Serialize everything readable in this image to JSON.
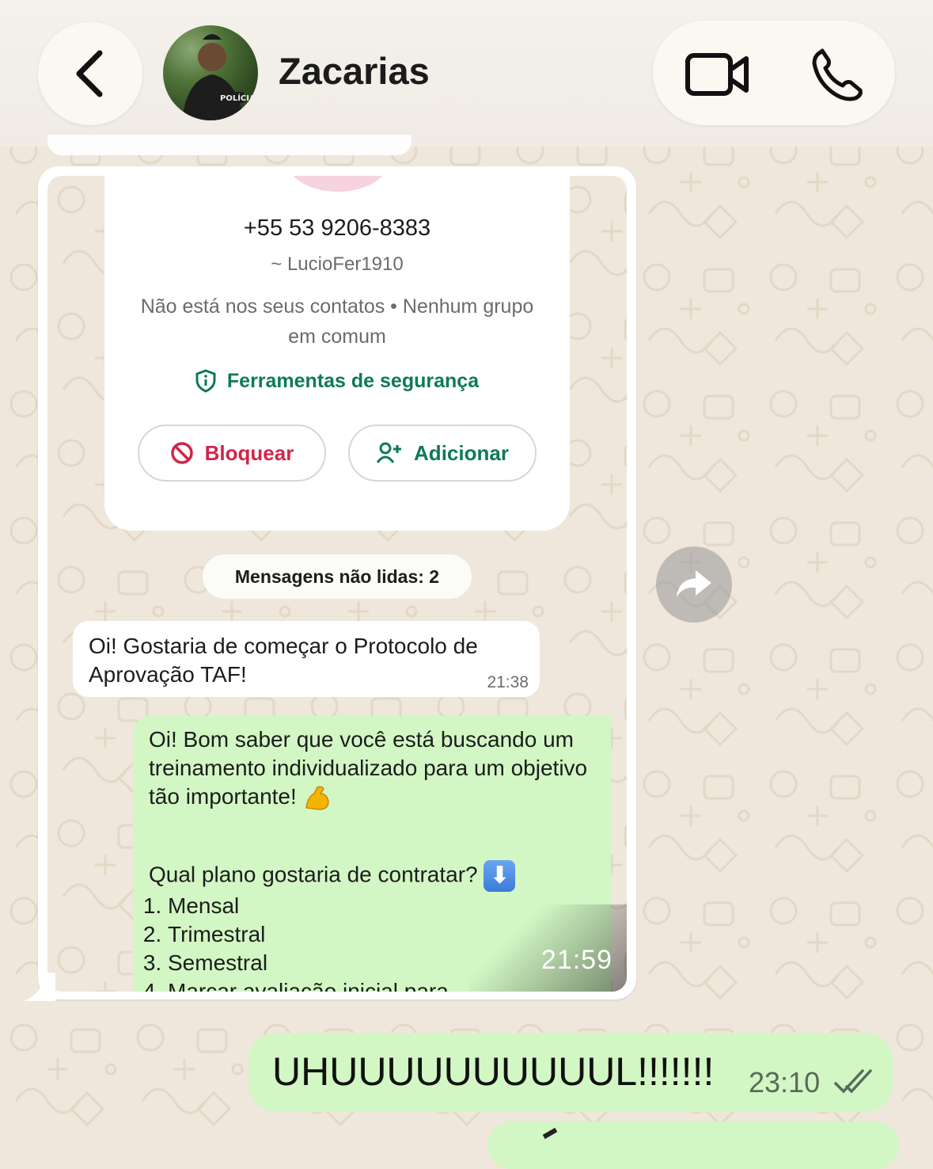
{
  "header": {
    "contact_name": "Zacarias",
    "back_icon": "chevron-left-icon",
    "video_icon": "video-camera-icon",
    "call_icon": "phone-icon"
  },
  "forwarded_screenshot": {
    "profile_card": {
      "phone": "+55 53 9206-8383",
      "username": "~ LucioFer1910",
      "status": "Não está nos seus contatos • Nenhum grupo em comum",
      "security_label": "Ferramentas de segurança",
      "block_label": "Bloquear",
      "add_label": "Adicionar"
    },
    "unread_label": "Mensagens não lidas: 2",
    "incoming": {
      "text": "Oi! Gostaria de começar o Protocolo de Aprovação TAF!",
      "time": "21:38"
    },
    "outgoing": {
      "line1": "Oi! Bom saber que você está buscando um treinamento individualizado para um objetivo tão importante!",
      "line2": "Qual plano gostaria de contratar?",
      "options": [
        "Mensal",
        "Trimestral",
        "Semestral",
        "Marcar avaliação inicial para"
      ]
    },
    "image_time": "21:59"
  },
  "sent_message": {
    "text": "UHUUUUUUUUUUL!!!!!!!",
    "time": "23:10"
  },
  "colors": {
    "wallpaper": "#efe7dc",
    "sent_bubble": "#d2f7c4",
    "green_accent": "#0e7a5a",
    "red_accent": "#d1254b"
  }
}
